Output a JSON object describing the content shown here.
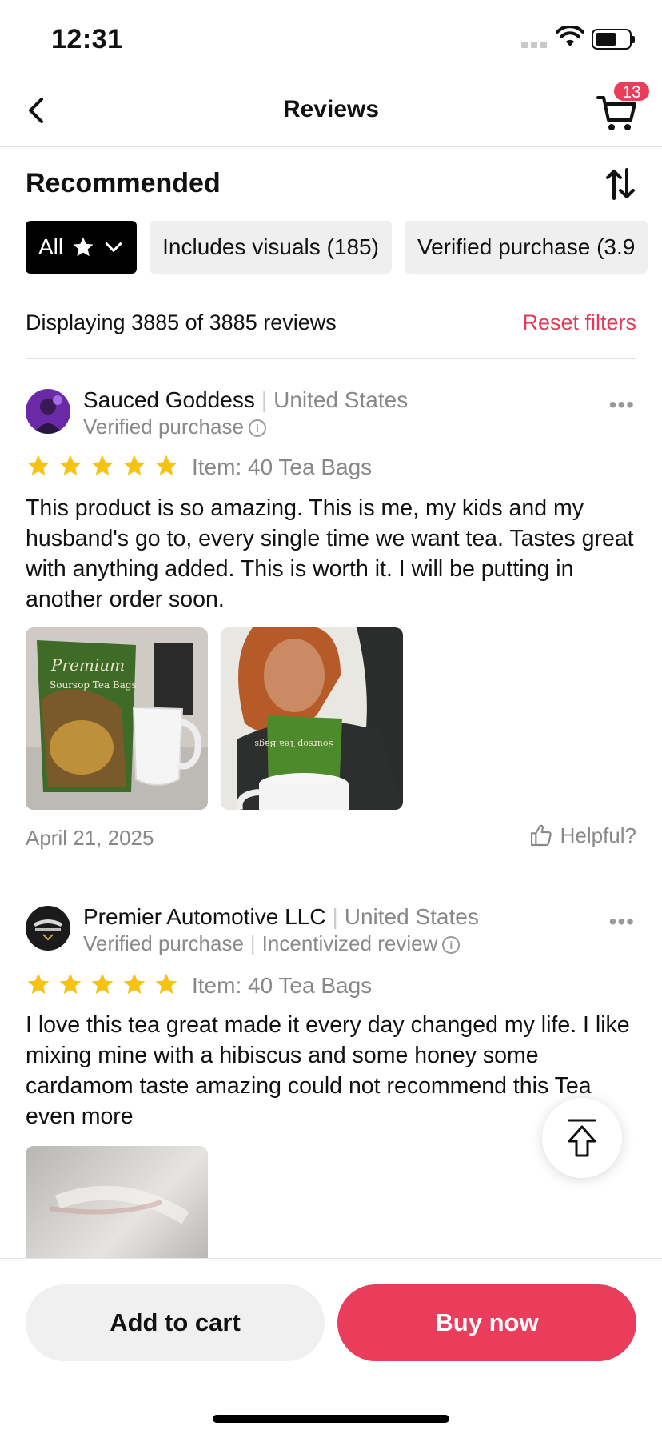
{
  "status_bar": {
    "time": "12:31"
  },
  "header": {
    "title": "Reviews",
    "cart_count": "13"
  },
  "sort": {
    "label": "Recommended"
  },
  "filters": {
    "all_label": "All",
    "chips": [
      "Includes visuals (185)",
      "Verified purchase (3.9"
    ]
  },
  "summary": {
    "display_text": "Displaying 3885 of 3885 reviews",
    "reset_label": "Reset filters"
  },
  "reviews": [
    {
      "name": "Sauced Goddess",
      "country": "United States",
      "badges": [
        "Verified purchase"
      ],
      "rating": 5,
      "item": "Item: 40 Tea Bags",
      "text": "This product is so amazing. This is me, my kids and my husband's go to, every single time we want tea. Tastes great with anything added. This is worth it. I will be putting in another order soon.",
      "photo_labels": [
        "Premium",
        "Soursop Tea Bags"
      ],
      "date": "April 21, 2025",
      "helpful_label": "Helpful?"
    },
    {
      "name": "Premier Automotive LLC",
      "country": "United States",
      "badges": [
        "Verified purchase",
        "Incentivized review"
      ],
      "rating": 5,
      "item": "Item: 40 Tea Bags",
      "text": "I love this tea great made it every day changed my life. I like mixing mine with a hibiscus and some honey some cardamom taste amazing could not recommend this Tea even more"
    }
  ],
  "actions": {
    "add_to_cart": "Add to cart",
    "buy_now": "Buy now"
  },
  "colors": {
    "accent": "#ea3d5c",
    "star": "#f6c312"
  }
}
